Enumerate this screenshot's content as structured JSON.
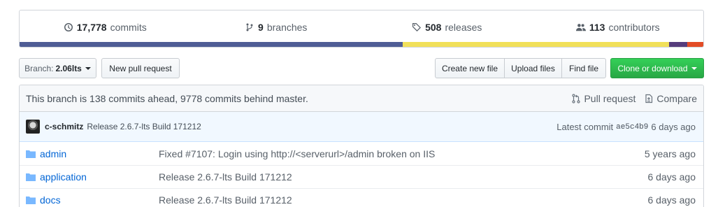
{
  "summary": {
    "commits": {
      "count": "17,778",
      "label": "commits"
    },
    "branches": {
      "count": "9",
      "label": "branches"
    },
    "releases": {
      "count": "508",
      "label": "releases"
    },
    "contributors": {
      "count": "113",
      "label": "contributors"
    }
  },
  "languages": [
    {
      "color": "#4f5d95",
      "share": 0.56
    },
    {
      "color": "#f1e05a",
      "share": 0.39
    },
    {
      "color": "#563d7c",
      "share": 0.027
    },
    {
      "color": "#e34c26",
      "share": 0.023
    }
  ],
  "toolbar": {
    "branch_prefix": "Branch:",
    "branch_name": "2.06lts",
    "new_pull_request": "New pull request",
    "create_new_file": "Create new file",
    "upload_files": "Upload files",
    "find_file": "Find file",
    "clone_or_download": "Clone or download"
  },
  "branch_info": {
    "text": "This branch is 138 commits ahead, 9778 commits behind master.",
    "pull_request": "Pull request",
    "compare": "Compare"
  },
  "latest_commit": {
    "author": "c-schmitz",
    "message": "Release 2.6.7-lts Build 171212",
    "label": "Latest commit",
    "sha": "ae5c4b9",
    "age": "6 days ago"
  },
  "files": [
    {
      "name": "admin",
      "message": "Fixed #7107: Login using http://<serverurl>/admin broken on IIS",
      "age": "5 years ago"
    },
    {
      "name": "application",
      "message": "Release 2.6.7-lts Build 171212",
      "age": "6 days ago"
    },
    {
      "name": "docs",
      "message": "Release 2.6.7-lts Build 171212",
      "age": "6 days ago"
    }
  ]
}
